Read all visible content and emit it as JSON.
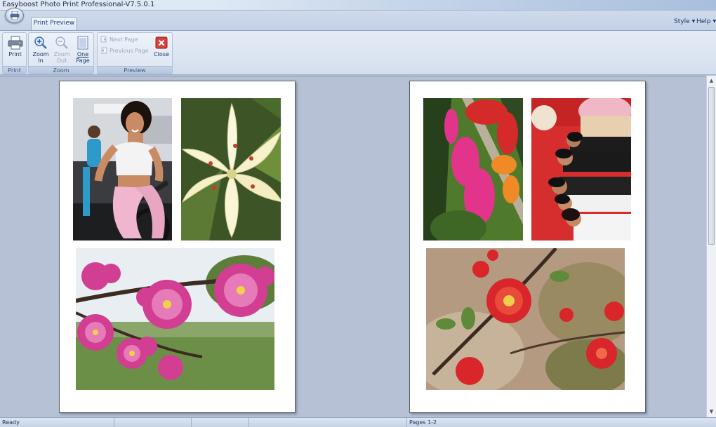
{
  "window": {
    "title": "Easyboost Photo Print Professional-V7.5.0.1"
  },
  "tabs": [
    {
      "label": "Print Preview",
      "active": true
    }
  ],
  "menu_right": {
    "style_label": "Style",
    "help_label": "Help"
  },
  "ribbon": {
    "print_group": {
      "label": "Print",
      "print_button": "Print"
    },
    "zoom_group": {
      "label": "Zoom",
      "zoom_in_line1": "Zoom",
      "zoom_in_line2": "In",
      "zoom_out_line1": "Zoom",
      "zoom_out_line2": "Out",
      "one_page_line1": "One",
      "one_page_line2": "Page"
    },
    "preview_group": {
      "label": "Preview",
      "next_page": "Next Page",
      "previous_page": "Previous Page",
      "close": "Close"
    }
  },
  "pages": [
    {
      "photos": [
        "Woman on exercise bike",
        "White lily",
        "Pink plum blossoms"
      ]
    },
    {
      "photos": [
        "Flower garden path",
        "Group photo",
        "Red quince blossom"
      ]
    }
  ],
  "status": {
    "left": "Ready",
    "pages": "Pages 1-2"
  },
  "colors": {
    "accent": "#15428b",
    "page_bg": "#b6c1d5"
  }
}
